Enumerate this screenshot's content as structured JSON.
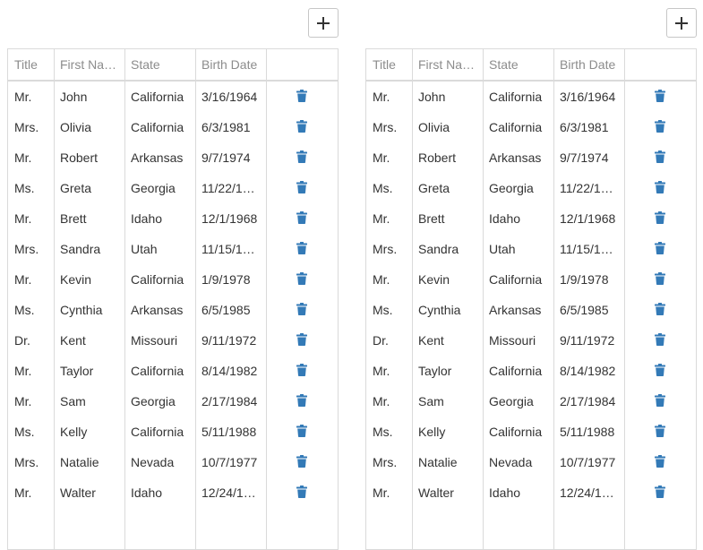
{
  "grids": [
    {
      "columns": [
        "Title",
        "First Na…",
        "State",
        "Birth Date"
      ],
      "rows": [
        [
          "Mr.",
          "John",
          "California",
          "3/16/1964"
        ],
        [
          "Mrs.",
          "Olivia",
          "California",
          "6/3/1981"
        ],
        [
          "Mr.",
          "Robert",
          "Arkansas",
          "9/7/1974"
        ],
        [
          "Ms.",
          "Greta",
          "Georgia",
          "11/22/1…"
        ],
        [
          "Mr.",
          "Brett",
          "Idaho",
          "12/1/1968"
        ],
        [
          "Mrs.",
          "Sandra",
          "Utah",
          "11/15/1…"
        ],
        [
          "Mr.",
          "Kevin",
          "California",
          "1/9/1978"
        ],
        [
          "Ms.",
          "Cynthia",
          "Arkansas",
          "6/5/1985"
        ],
        [
          "Dr.",
          "Kent",
          "Missouri",
          "9/11/1972"
        ],
        [
          "Mr.",
          "Taylor",
          "California",
          "8/14/1982"
        ],
        [
          "Mr.",
          "Sam",
          "Georgia",
          "2/17/1984"
        ],
        [
          "Ms.",
          "Kelly",
          "California",
          "5/11/1988"
        ],
        [
          "Mrs.",
          "Natalie",
          "Nevada",
          "10/7/1977"
        ],
        [
          "Mr.",
          "Walter",
          "Idaho",
          "12/24/1…"
        ]
      ]
    },
    {
      "columns": [
        "Title",
        "First Na…",
        "State",
        "Birth Date"
      ],
      "rows": [
        [
          "Mr.",
          "John",
          "California",
          "3/16/1964"
        ],
        [
          "Mrs.",
          "Olivia",
          "California",
          "6/3/1981"
        ],
        [
          "Mr.",
          "Robert",
          "Arkansas",
          "9/7/1974"
        ],
        [
          "Ms.",
          "Greta",
          "Georgia",
          "11/22/1…"
        ],
        [
          "Mr.",
          "Brett",
          "Idaho",
          "12/1/1968"
        ],
        [
          "Mrs.",
          "Sandra",
          "Utah",
          "11/15/1…"
        ],
        [
          "Mr.",
          "Kevin",
          "California",
          "1/9/1978"
        ],
        [
          "Ms.",
          "Cynthia",
          "Arkansas",
          "6/5/1985"
        ],
        [
          "Dr.",
          "Kent",
          "Missouri",
          "9/11/1972"
        ],
        [
          "Mr.",
          "Taylor",
          "California",
          "8/14/1982"
        ],
        [
          "Mr.",
          "Sam",
          "Georgia",
          "2/17/1984"
        ],
        [
          "Ms.",
          "Kelly",
          "California",
          "5/11/1988"
        ],
        [
          "Mrs.",
          "Natalie",
          "Nevada",
          "10/7/1977"
        ],
        [
          "Mr.",
          "Walter",
          "Idaho",
          "12/24/1…"
        ]
      ]
    }
  ],
  "icons": {
    "add": "plus-icon",
    "delete": "trash-icon"
  },
  "colors": {
    "accent": "#337ab7",
    "border": "#dadada",
    "header_text": "#8c8c8c"
  }
}
